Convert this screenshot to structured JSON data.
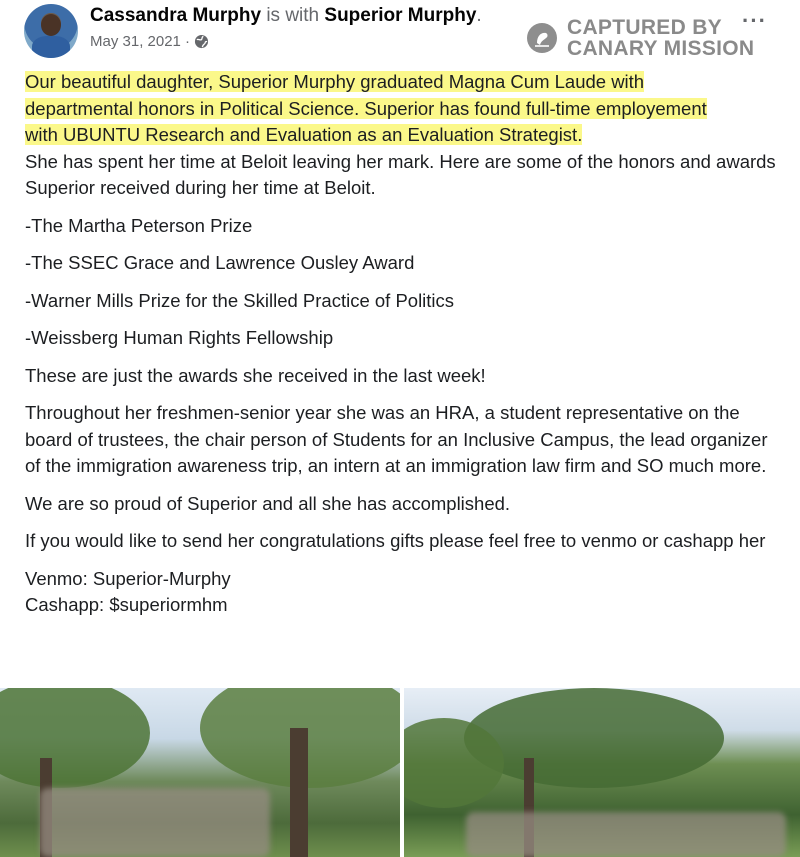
{
  "post": {
    "author": "Cassandra Murphy",
    "with_text": "is with",
    "tagged": "Superior Murphy",
    "tagged_suffix": ".",
    "date": "May 31, 2021 ·",
    "more": "···",
    "watermark": {
      "line1": "CAPTURED BY",
      "line2": "CANARY MISSION"
    },
    "highlight_lines": [
      "Our beautiful daughter, Superior Murphy graduated Magna Cum Laude with",
      "departmental honors in Political Science. Superior has found full-time employement",
      "with UBUNTU Research and Evaluation as an Evaluation Strategist."
    ],
    "paragraphs": [
      "She has spent her time at Beloit leaving her mark. Here are some of the honors and awards Superior received during her time at Beloit.",
      "-The Martha Peterson Prize",
      "-The SSEC Grace and Lawrence Ousley Award",
      "-Warner Mills Prize for the Skilled Practice of Politics",
      "-Weissberg Human Rights Fellowship",
      "These are just the awards she received in the last week!",
      "Throughout her freshmen-senior year she was an HRA, a student representative on the board of trustees, the chair person of Students for an Inclusive Campus, the lead organizer of the immigration awareness trip,  an intern at an immigration law firm and SO much more.",
      "We are so proud of Superior and all she has accomplished.",
      "If you would like to send her congratulations gifts please feel free to venmo or cashapp her"
    ],
    "payment": {
      "venmo": "Venmo: Superior-Murphy",
      "cashapp": "Cashapp: $superiormhm"
    }
  },
  "icons": {
    "avatar": "avatar",
    "privacy": "globe-icon",
    "watermark": "canary-icon",
    "more": "more-options-icon"
  },
  "colors": {
    "highlight": "#fbf88a",
    "secondary_text": "#65676b",
    "watermark": "#8a8a8a"
  }
}
